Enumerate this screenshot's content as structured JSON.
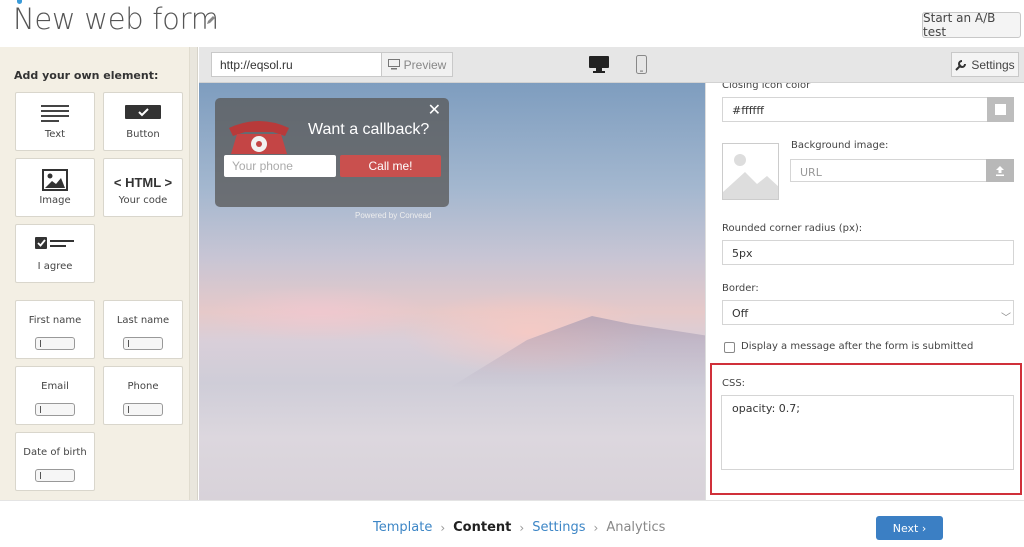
{
  "header": {
    "title": "New web form",
    "ab_test_label": "Start an A/B test"
  },
  "sidebar": {
    "title": "Add your own element:",
    "elements": [
      {
        "label": "Text",
        "icon": "text-lines-icon"
      },
      {
        "label": "Button",
        "icon": "button-check-icon"
      },
      {
        "label": "Image",
        "icon": "image-icon"
      },
      {
        "label": "Your code",
        "icon": "html-icon",
        "icon_text": "< HTML >"
      },
      {
        "label": "I agree",
        "icon": "checkbox-agree-icon"
      }
    ],
    "fields": [
      {
        "label": "First name"
      },
      {
        "label": "Last name"
      },
      {
        "label": "Email"
      },
      {
        "label": "Phone"
      },
      {
        "label": "Date of birth"
      }
    ]
  },
  "toolbar": {
    "url": "http://eqsol.ru",
    "preview_label": "Preview",
    "settings_label": "Settings"
  },
  "popup": {
    "headline": "Want a callback?",
    "phone_placeholder": "Your phone",
    "call_button": "Call me!",
    "powered_by": "Powered by Convead"
  },
  "settings": {
    "closing_icon_color_label": "Closing icon color",
    "closing_icon_color_value": "#ffffff",
    "background_image_label": "Background image:",
    "background_image_placeholder": "URL",
    "radius_label": "Rounded corner radius (px):",
    "radius_value": "5px",
    "border_label": "Border:",
    "border_value": "Off",
    "display_message_label": "Display a message after the form is submitted",
    "css_label": "CSS:",
    "css_value": "opacity: 0.7;"
  },
  "footer": {
    "steps": [
      "Template",
      "Content",
      "Settings",
      "Analytics"
    ],
    "next_label": "Next"
  },
  "colors": {
    "accent": "#3b7fc4",
    "call_button": "#c9504e",
    "highlight": "#d0303a"
  }
}
